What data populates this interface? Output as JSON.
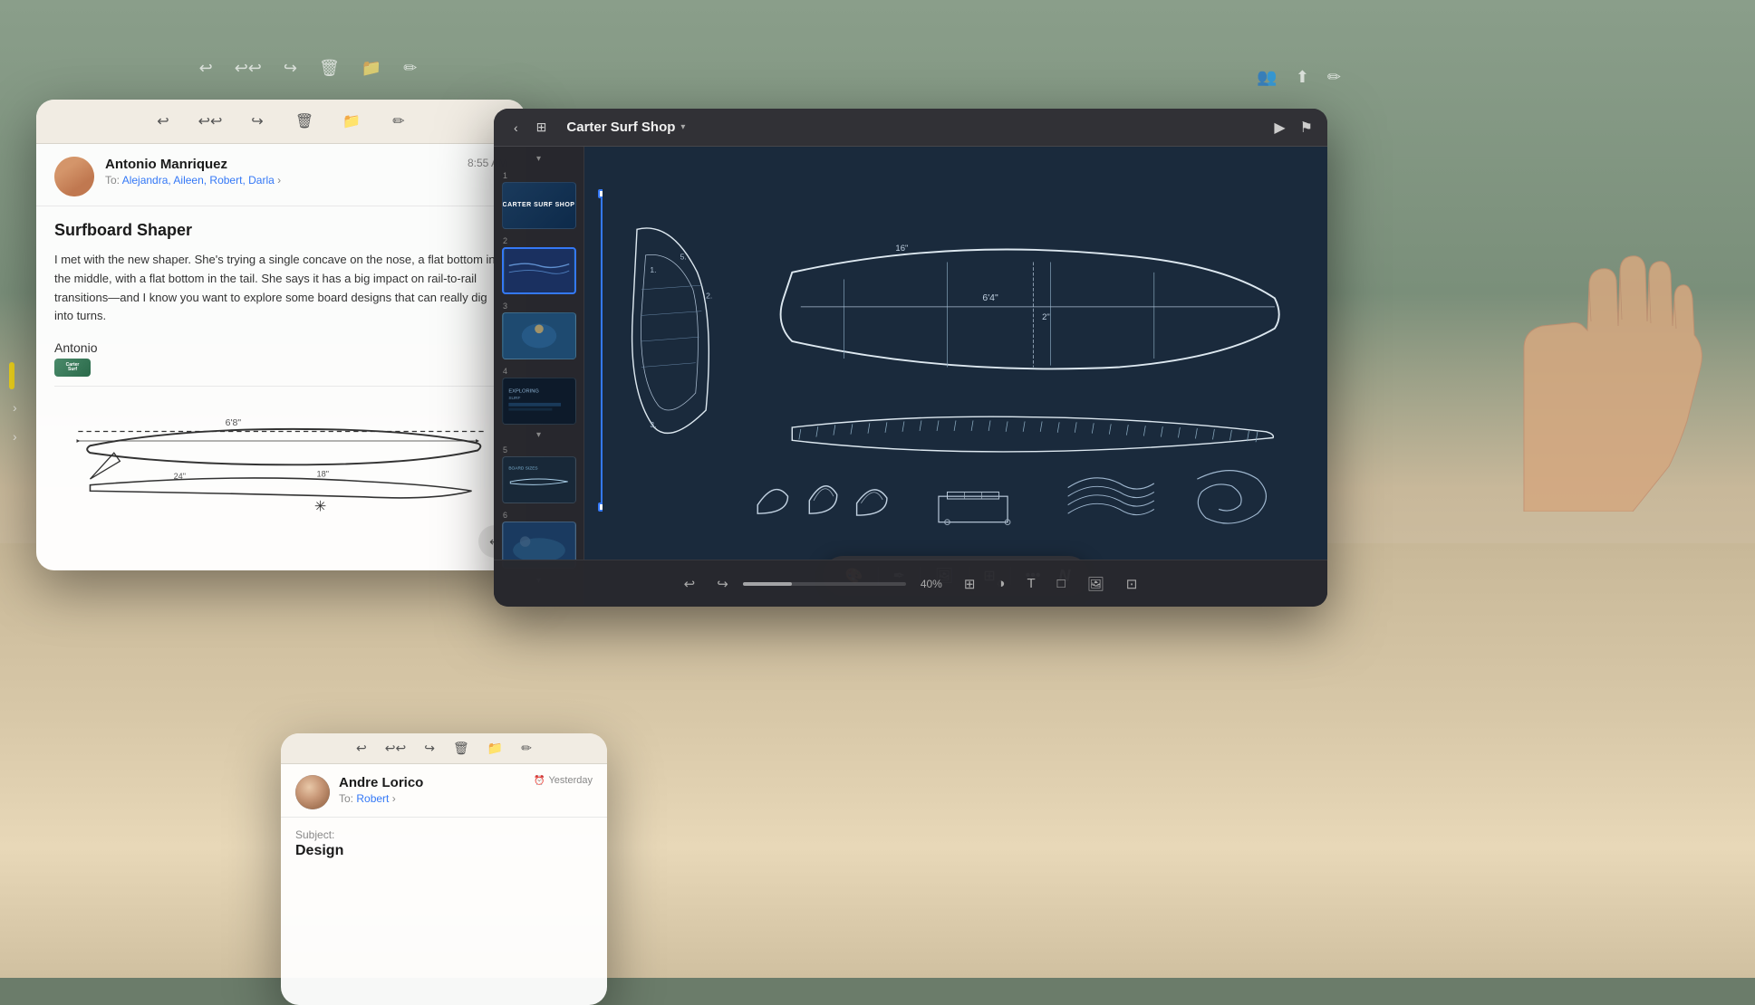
{
  "background": {
    "description": "Kitchen/living room scene with wooden cabinets"
  },
  "email_main": {
    "sender": "Antonio Manriquez",
    "to_label": "To:",
    "recipients": "Alejandra, Aileen, Robert, Darla",
    "time": "8:55 AM",
    "subject": "Surfboard Shaper",
    "body_text": "I met with the new shaper. She's trying a single concave on the nose, a flat bottom in the middle, with a flat bottom in the tail. She says it has a big impact on rail-to-rail transitions—and I know you want to explore some board designs that can really dig into turns.",
    "signature": "Antonio",
    "toolbar": {
      "reply_all": "↩",
      "reply": "↩↩",
      "forward": "↪",
      "trash": "🗑",
      "folder": "📁",
      "compose": "✏"
    }
  },
  "presentation": {
    "title": "Carter Surf Shop",
    "logo_text": "carTER SURf shop",
    "toolbar": {
      "back": "‹",
      "book_icon": "⊞",
      "dropdown": "▾",
      "play": "▶",
      "flag": "⚑",
      "users": "👥",
      "share": "⬆",
      "annotate": "✏"
    },
    "slides": [
      {
        "number": "1",
        "type": "logo"
      },
      {
        "number": "2",
        "type": "wave"
      },
      {
        "number": "3",
        "type": "surfer"
      },
      {
        "number": "4",
        "type": "dark"
      },
      {
        "number": "5",
        "type": "board"
      },
      {
        "number": "6",
        "type": "surf2"
      }
    ],
    "current_slide_number": "2",
    "bottom_bar": {
      "undo_label": "↩",
      "redo_label": "↪",
      "zoom_label": "40%",
      "table_icon": "⊞",
      "chart_icon": "◑",
      "text_icon": "T",
      "shape_icon": "□",
      "media_icon": "🖼",
      "view_icon": "⊡"
    },
    "format_toolbar": {
      "paint_icon": "🎨",
      "pen_icon": "✒",
      "image_icon": "🖼",
      "layout_icon": "⊞",
      "more_icon": "•••",
      "n_label": "N"
    }
  },
  "email_bottom": {
    "sender": "Andre Lorico",
    "to_label": "To:",
    "recipient": "Robert",
    "time_label": "Yesterday",
    "subject_preview": "Design",
    "toolbar": {
      "reply": "↩",
      "reply_all": "↩↩",
      "forward": "↪",
      "trash": "🗑",
      "folder": "📁",
      "compose": "✏"
    }
  },
  "left_sidebar": {
    "expand_left": "›",
    "expand_right": "›"
  },
  "icons": {
    "reply": "↩",
    "reply_all": "↩↩",
    "forward": "↪",
    "trash": "🗑",
    "archive": "📁",
    "compose": "✏",
    "chevron_left": "‹",
    "chevron_right": "›",
    "chevron_down": "▾",
    "play": "▶",
    "share": "⬆",
    "more": "•••",
    "clock": "◑",
    "table": "⊞"
  }
}
